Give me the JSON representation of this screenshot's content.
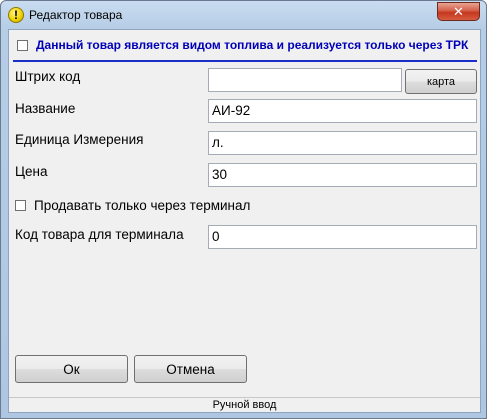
{
  "window": {
    "title": "Редактор товара",
    "close_label": "✕"
  },
  "form": {
    "fuel_checkbox": {
      "label": "Данный товар является видом топлива и реализуется только через ТРК",
      "checked": false
    },
    "barcode": {
      "label": "Штрих код",
      "value": "",
      "card_button": "карта"
    },
    "name": {
      "label": "Название",
      "value": "АИ-92"
    },
    "unit": {
      "label": "Единица Измерения",
      "value": "л."
    },
    "price": {
      "label": "Цена",
      "value": "30"
    },
    "terminal_only": {
      "label": "Продавать только через терминал",
      "checked": false
    },
    "terminal_code": {
      "label": "Код товара для терминала",
      "value": "0"
    }
  },
  "buttons": {
    "ok": "Ок",
    "cancel": "Отмена"
  },
  "status": {
    "text": "Ручной ввод"
  },
  "colors": {
    "fuel_label": "#0000b8",
    "separator": "#1a2fc7",
    "close_button": "#c4381f"
  }
}
